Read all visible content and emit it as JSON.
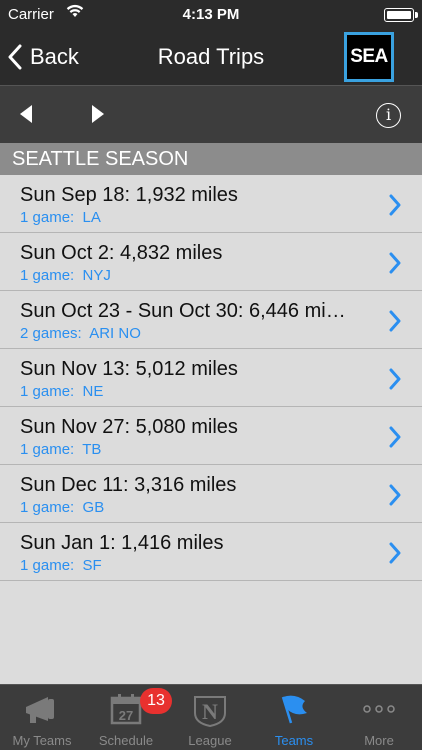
{
  "status_bar": {
    "carrier": "Carrier",
    "time": "4:13 PM"
  },
  "nav": {
    "back_label": "Back",
    "title": "Road Trips",
    "team_logo_text": "SEA"
  },
  "section": {
    "title": "SEATTLE SEASON"
  },
  "trips": [
    {
      "title": "Sun Sep 18:  1,932 miles",
      "games": "1 game:  LA"
    },
    {
      "title": "Sun Oct 2:  4,832 miles",
      "games": "1 game:  NYJ"
    },
    {
      "title": "Sun Oct 23 - Sun Oct 30:  6,446 mi…",
      "games": "2 games:  ARI NO"
    },
    {
      "title": "Sun Nov 13:  5,012 miles",
      "games": "1 game:  NE"
    },
    {
      "title": "Sun Nov 27:  5,080 miles",
      "games": "1 game:  TB"
    },
    {
      "title": "Sun Dec 11:  3,316 miles",
      "games": "1 game:  GB"
    },
    {
      "title": "Sun Jan 1:  1,416 miles",
      "games": "1 game:  SF"
    }
  ],
  "tabs": [
    {
      "label": "My Teams",
      "icon": "megaphone-icon"
    },
    {
      "label": "Schedule",
      "icon": "calendar-icon",
      "calendar_day": "27",
      "badge": "13"
    },
    {
      "label": "League",
      "icon": "nfl-shield-icon",
      "logo_letter": "N"
    },
    {
      "label": "Teams",
      "icon": "flag-icon",
      "active": true
    },
    {
      "label": "More",
      "icon": "more-dots-icon"
    }
  ],
  "colors": {
    "accent": "#2b8ff0",
    "bar": "#2b2b2b",
    "badge": "#e8312f"
  }
}
